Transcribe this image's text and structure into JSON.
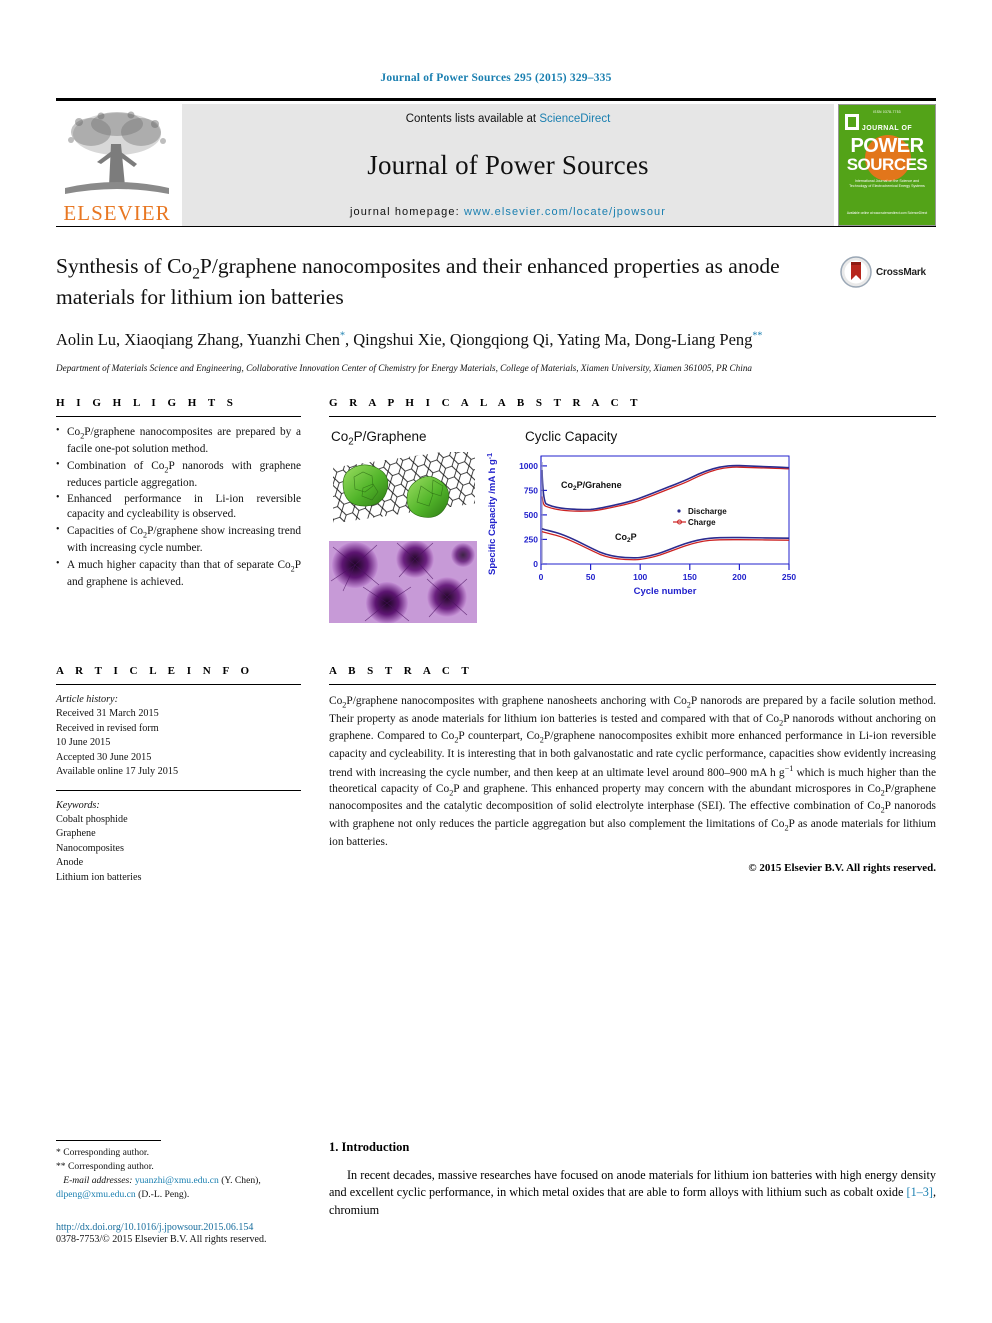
{
  "running_head": "Journal of Power Sources 295 (2015) 329–335",
  "masthead": {
    "contents_prefix": "Contents lists available at ",
    "sciencedirect": "ScienceDirect",
    "journal_name": "Journal of Power Sources",
    "homepage_prefix": "journal homepage: ",
    "homepage_url": "www.elsevier.com/locate/jpowsour",
    "publisher": "ELSEVIER",
    "cover": {
      "top_line": "ISSN 0378-7753",
      "journal_of": "JOURNAL OF",
      "power": "POWER",
      "sources": "SOURCES",
      "subtitle": "International Journal on the Science and Technology of Electrochemical Energy Systems",
      "footer": "Available online at www.sciencedirect.com  ScienceDirect"
    }
  },
  "article": {
    "title": "Synthesis of Co2P/graphene nanocomposites and their enhanced properties as anode materials for lithium ion batteries",
    "authors": "Aolin Lu, Xiaoqiang Zhang, Yuanzhi Chen, Qingshui Xie, Qiongqiong Qi, Yating Ma, Dong-Liang Peng",
    "affiliation": "Department of Materials Science and Engineering, Collaborative Innovation Center of Chemistry for Energy Materials, College of Materials, Xiamen University, Xiamen 361005, PR China",
    "crossmark_label": "CrossMark"
  },
  "sections": {
    "highlights_heading": "H I G H L I G H T S",
    "graphical_abstract_heading": "G R A P H I C A L   A B S T R A C T",
    "article_info_heading": "A R T I C L E   I N F O",
    "abstract_heading": "A B S T R A C T"
  },
  "highlights": [
    "Co2P/graphene nanocomposites are prepared by a facile one-pot solution method.",
    "Combination of Co2P nanorods with graphene reduces particle aggregation.",
    "Enhanced performance in Li-ion reversible capacity and cycleability is observed.",
    "Capacities of Co2P/graphene show increasing trend with increasing cycle number.",
    "A much higher capacity than that of separate Co2P and graphene is achieved."
  ],
  "graphical_abstract": {
    "left_label": "Co2P/Graphene",
    "right_label": "Cyclic Capacity"
  },
  "chart_data": {
    "type": "line",
    "title": "Cyclic Capacity",
    "xlabel": "Cycle number",
    "ylabel": "Specific Capacity /mA h g⁻¹",
    "xlim": [
      0,
      250
    ],
    "ylim": [
      0,
      1100
    ],
    "xticks": [
      0,
      50,
      100,
      150,
      200,
      250
    ],
    "yticks": [
      0,
      250,
      500,
      750,
      1000
    ],
    "grid": false,
    "legend": [
      "Discharge",
      "Charge"
    ],
    "legend_position": "center-right",
    "annotations": [
      "Co2P/Grahene",
      "Co2P"
    ],
    "colors": {
      "discharge": "#2b2b8f",
      "charge": "#cc2222",
      "axis": "#2222cc"
    },
    "series": [
      {
        "name": "Co2P/Graphene Discharge",
        "x": [
          1,
          3,
          5,
          10,
          20,
          30,
          40,
          50,
          60,
          70,
          80,
          90,
          100,
          110,
          120,
          130,
          140,
          150,
          160,
          170,
          180,
          190,
          200,
          210,
          220,
          230,
          240,
          250
        ],
        "values": [
          1080,
          640,
          600,
          580,
          560,
          548,
          540,
          538,
          545,
          562,
          590,
          618,
          650,
          672,
          700,
          730,
          760,
          790,
          820,
          862,
          890,
          898,
          896,
          892,
          890,
          888,
          884,
          880
        ]
      },
      {
        "name": "Co2P/Graphene Charge",
        "x": [
          1,
          3,
          5,
          10,
          20,
          30,
          40,
          50,
          60,
          70,
          80,
          90,
          100,
          110,
          120,
          130,
          140,
          150,
          160,
          170,
          180,
          190,
          200,
          210,
          220,
          230,
          240,
          250
        ],
        "values": [
          700,
          620,
          590,
          572,
          552,
          540,
          533,
          531,
          538,
          555,
          582,
          610,
          642,
          664,
          692,
          722,
          752,
          782,
          812,
          854,
          882,
          890,
          888,
          884,
          882,
          880,
          876,
          872
        ]
      },
      {
        "name": "Co2P Discharge",
        "x": [
          1,
          3,
          5,
          10,
          20,
          30,
          40,
          50,
          60,
          70,
          80,
          90,
          100,
          110,
          120,
          130,
          140,
          150,
          160,
          170,
          180,
          190,
          200,
          210,
          220,
          230,
          240,
          250
        ],
        "values": [
          360,
          340,
          332,
          325,
          310,
          288,
          258,
          222,
          185,
          152,
          128,
          115,
          112,
          115,
          122,
          132,
          145,
          160,
          175,
          188,
          196,
          200,
          200,
          199,
          198,
          198,
          197,
          196
        ]
      },
      {
        "name": "Co2P Charge",
        "x": [
          1,
          3,
          5,
          10,
          20,
          30,
          40,
          50,
          60,
          70,
          80,
          90,
          100,
          110,
          120,
          130,
          140,
          150,
          160,
          170,
          180,
          190,
          200,
          210,
          220,
          230,
          240,
          250
        ],
        "values": [
          330,
          325,
          320,
          315,
          302,
          281,
          251,
          216,
          180,
          148,
          124,
          111,
          108,
          111,
          118,
          128,
          141,
          156,
          171,
          184,
          192,
          196,
          196,
          195,
          194,
          194,
          193,
          192
        ]
      }
    ]
  },
  "article_info": {
    "history_label": "Article history:",
    "history": [
      "Received 31 March 2015",
      "Received in revised form",
      "10 June 2015",
      "Accepted 30 June 2015",
      "Available online 17 July 2015"
    ],
    "keywords_label": "Keywords:",
    "keywords": [
      "Cobalt phosphide",
      "Graphene",
      "Nanocomposites",
      "Anode",
      "Lithium ion batteries"
    ]
  },
  "abstract": {
    "text": "Co2P/graphene nanocomposites with graphene nanosheets anchoring with Co2P nanorods are prepared by a facile solution method. Their property as anode materials for lithium ion batteries is tested and compared with that of Co2P nanorods without anchoring on graphene. Compared to Co2P counterpart, Co2P/graphene nanocomposites exhibit more enhanced performance in Li-ion reversible capacity and cycleability. It is interesting that in both galvanostatic and rate cyclic performance, capacities show evidently increasing trend with increasing the cycle number, and then keep at an ultimate level around 800–900 mA h g−1 which is much higher than the theoretical capacity of Co2P and graphene. This enhanced property may concern with the abundant microspores in Co2P/graphene nanocomposites and the catalytic decomposition of solid electrolyte interphase (SEI). The effective combination of Co2P nanorods with graphene not only reduces the particle aggregation but also complement the limitations of Co2P as anode materials for lithium ion batteries.",
    "copyright": "© 2015 Elsevier B.V. All rights reserved."
  },
  "footnotes": {
    "star1": "* Corresponding author.",
    "star2": "** Corresponding author.",
    "email_label": "E-mail addresses:",
    "email1": "yuanzhi@xmu.edu.cn",
    "email1_owner": "(Y. Chen),",
    "email2": "dlpeng@xmu.edu.cn",
    "email2_owner": "(D.-L. Peng).",
    "doi": "http://dx.doi.org/10.1016/j.jpowsour.2015.06.154",
    "issn": "0378-7753/© 2015 Elsevier B.V. All rights reserved."
  },
  "introduction": {
    "heading": "1. Introduction",
    "paragraph_part1": "In recent decades, massive researches have focused on anode materials for lithium ion batteries with high energy density and excellent cyclic performance, in which metal oxides that are able to form alloys with lithium such as cobalt oxide ",
    "citation": "[1–3]",
    "paragraph_part2": ", chromium"
  }
}
